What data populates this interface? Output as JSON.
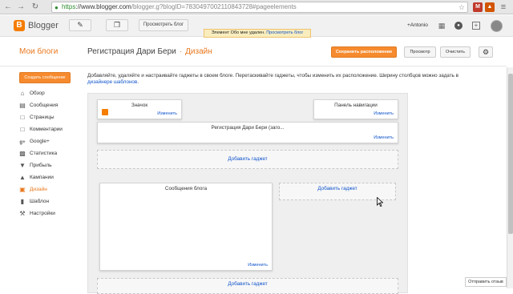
{
  "browser": {
    "url_scheme": "https",
    "url_host": "://www.blogger.com",
    "url_path": "/blogger.g?blogID=7830497002110843728#pageelements",
    "back_icon": "arrow-left",
    "forward_icon": "arrow-right",
    "reload_icon": "reload"
  },
  "header": {
    "logo_letter": "B",
    "logo_text": "Blogger",
    "edit_icon": "pencil",
    "pages_icon": "copy",
    "view_blog_label": "Просмотреть блог",
    "user_name": "+Antonio",
    "apps_icon": "grid",
    "notifications_icon": "bell",
    "share_icon": "plus"
  },
  "notice": {
    "text": "Элемент Обо мне удален.",
    "link": "Просмотреть блог"
  },
  "titlebar": {
    "my_blogs": "Мои блоги",
    "blog_title": "Регистрация Дари Бери",
    "separator": "·",
    "page_name": "Дизайн",
    "save_label": "Сохранить расположение",
    "preview_label": "Просмотр",
    "clear_label": "Очистить",
    "settings_icon": "gear"
  },
  "sidebar": {
    "new_post_label": "Создать сообщение",
    "items": [
      {
        "label": "Обзор",
        "icon": "home"
      },
      {
        "label": "Сообщения",
        "icon": "document"
      },
      {
        "label": "Страницы",
        "icon": "page"
      },
      {
        "label": "Комментарии",
        "icon": "comment"
      },
      {
        "label": "Google+",
        "icon": "google-plus"
      },
      {
        "label": "Статистика",
        "icon": "bar-chart"
      },
      {
        "label": "Прибыль",
        "icon": "trophy"
      },
      {
        "label": "Кампании",
        "icon": "campaign"
      },
      {
        "label": "Дизайн",
        "icon": "layout",
        "active": true
      },
      {
        "label": "Шаблон",
        "icon": "template"
      },
      {
        "label": "Настройки",
        "icon": "wrench"
      }
    ]
  },
  "main": {
    "intro_text": "Добавляйте, удаляйте и настраивайте гаджеты в своем блоге. Перетаскивайте гаджеты, чтобы изменить их расположение. Ширину столбцов можно задать в",
    "intro_link": "дизайнере шаблонов",
    "intro_end": ".",
    "favicon_gadget": {
      "title": "Значок",
      "edit": "Изменить"
    },
    "navbar_gadget": {
      "title": "Панель навигации",
      "edit": "Изменить"
    },
    "header_gadget": {
      "title": "Регистрация Дари Бери (заго...",
      "edit": "Изменить"
    },
    "add_gadget_1": "Добавить гаджет",
    "posts_gadget": {
      "title": "Сообщения блога",
      "edit": "Изменить"
    },
    "add_gadget_sidebar": "Добавить гаджет",
    "add_gadget_2": "Добавить гаджет"
  },
  "footer": {
    "feedback_label": "Отправить отзыв"
  },
  "colors": {
    "accent": "#f68a2e",
    "link": "#1155cc"
  }
}
